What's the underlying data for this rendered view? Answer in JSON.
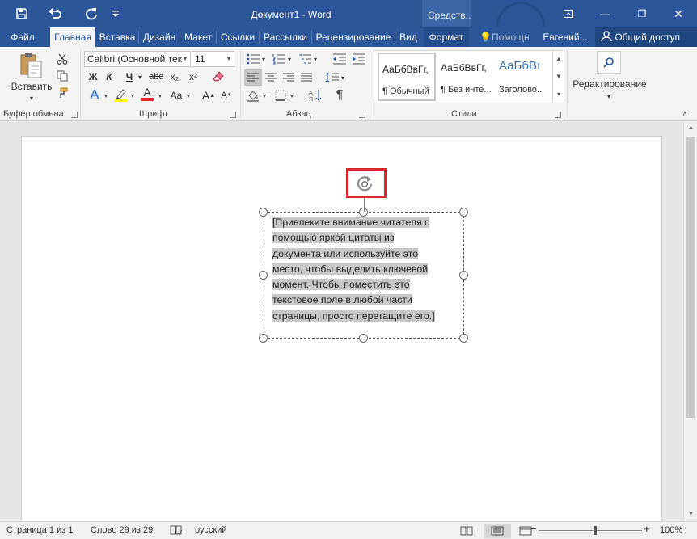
{
  "window": {
    "title": "Документ1 - Word",
    "context_tab_header": "Средств...",
    "minimize_glyph": "—",
    "restore_glyph": "❐",
    "close_glyph": "✕",
    "ribbon_display_icon": "ribbon-display-options-icon"
  },
  "tabs": [
    {
      "label": "Файл"
    },
    {
      "label": "Главная"
    },
    {
      "label": "Вставка"
    },
    {
      "label": "Дизайн"
    },
    {
      "label": "Макет"
    },
    {
      "label": "Ссылки"
    },
    {
      "label": "Рассылки"
    },
    {
      "label": "Рецензирование"
    },
    {
      "label": "Вид"
    },
    {
      "label": "Формат"
    }
  ],
  "tell_me": "Помощн",
  "user": "Евгений...",
  "share": "Общий доступ",
  "clipboard": {
    "paste": "Вставить",
    "group": "Буфер обмена"
  },
  "font": {
    "name": "Calibri (Основной тек",
    "size": "11",
    "bold": "Ж",
    "italic": "К",
    "underline": "Ч",
    "strike": "abc",
    "subscript": "x₂",
    "superscript": "x²",
    "grow": "A",
    "shrink": "A",
    "case": "Aa",
    "effects": "A",
    "color_letter": "A",
    "group": "Шрифт",
    "highlight_color": "#ffff00",
    "font_color": "#e0262b"
  },
  "paragraph": {
    "group": "Абзац",
    "pilcrow": "¶"
  },
  "styles": {
    "group": "Стили",
    "items": [
      {
        "sample": "АаБбВвГг,",
        "name": "¶ Обычный"
      },
      {
        "sample": "АаБбВвГг,",
        "name": "¶ Без инте..."
      },
      {
        "sample": "АаБбВı",
        "name": "Заголово..."
      }
    ]
  },
  "editing": {
    "label": "Редактирование"
  },
  "textbox": {
    "lines": [
      "[Привлеките внимание читателя с",
      "помощью яркой цитаты из",
      "документа или используйте это",
      "место, чтобы выделить ключевой",
      "момент. Чтобы поместить это",
      "текстовое поле в любой части",
      "страницы, просто перетащите его.]"
    ]
  },
  "status": {
    "page": "Страница 1 из 1",
    "words": "Слово 29 из 29",
    "language": "русский",
    "zoom_minus": "−",
    "zoom_plus": "+",
    "zoom": "100%",
    "zoom_level_percent": 100
  },
  "colors": {
    "accent": "#2b579a",
    "highlight_box": "#d9272e"
  }
}
